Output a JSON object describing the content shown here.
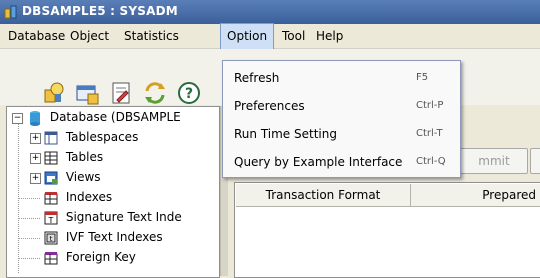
{
  "window": {
    "title": "DBSAMPLE5 : SYSADM"
  },
  "menubar": {
    "items": [
      {
        "label": "Database"
      },
      {
        "label": "Object"
      },
      {
        "label": "Statistics"
      },
      {
        "label": "Option"
      },
      {
        "label": "Tool"
      },
      {
        "label": "Help"
      }
    ],
    "active": "Option"
  },
  "toolbar": {
    "icons": [
      "connect-icon",
      "open-table-icon",
      "edit-icon",
      "refresh-icon",
      "help-icon"
    ]
  },
  "tree": {
    "root": {
      "label": "Database (DBSAMPLE",
      "icon": "database-icon"
    },
    "children": [
      {
        "label": "Tablespaces",
        "icon": "tablespace-icon",
        "expandable": true
      },
      {
        "label": "Tables",
        "icon": "table-icon",
        "expandable": true
      },
      {
        "label": "Views",
        "icon": "view-icon",
        "expandable": true
      },
      {
        "label": "Indexes",
        "icon": "index-icon",
        "expandable": false
      },
      {
        "label": "Signature Text Inde",
        "icon": "signature-index-icon",
        "expandable": false
      },
      {
        "label": "IVF Text Indexes",
        "icon": "ivf-index-icon",
        "expandable": false
      },
      {
        "label": "Foreign Key",
        "icon": "foreign-key-icon",
        "expandable": false
      }
    ]
  },
  "right_panel": {
    "commit_label": "mmit",
    "columns": [
      "Transaction Format",
      "Prepared"
    ]
  },
  "option_menu": {
    "items": [
      {
        "label": "Refresh",
        "accelerator": "F5"
      },
      {
        "label": "Preferences",
        "accelerator": "Ctrl-P"
      },
      {
        "label": "Run Time Setting",
        "accelerator": "Ctrl-T"
      },
      {
        "label": "Query by Example Interface",
        "accelerator": "Ctrl-Q"
      }
    ]
  },
  "colors": {
    "titlebar": "#3a5f9a",
    "menu_active": "#cfdff5",
    "menu_border": "#8c99b8"
  }
}
